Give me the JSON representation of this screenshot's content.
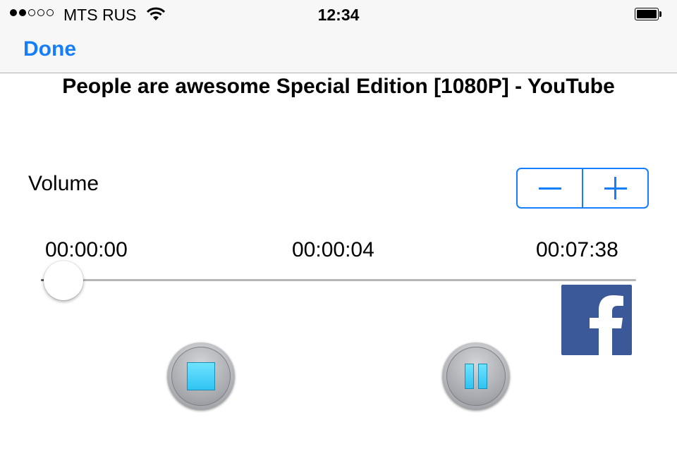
{
  "status_bar": {
    "signal_dots_filled": 2,
    "signal_dots_total": 5,
    "carrier": "MTS RUS",
    "time": "12:34",
    "icons": [
      "signal-dots-icon",
      "wifi-icon",
      "battery-icon"
    ]
  },
  "nav": {
    "done_label": "Done"
  },
  "title": "People are awesome Special Edition [1080P] - YouTube",
  "volume": {
    "label": "Volume",
    "decrement_icon": "minus-icon",
    "increment_icon": "plus-icon"
  },
  "playback": {
    "elapsed": "00:00:00",
    "current": "00:00:04",
    "duration": "00:07:38",
    "progress_fraction": 0.0
  },
  "share": {
    "icon": "facebook-icon"
  },
  "controls": {
    "stop_icon": "stop-icon",
    "pause_icon": "pause-icon"
  },
  "colors": {
    "accent": "#157efb",
    "facebook": "#3b5998",
    "control_glyph": "#2fc3f2"
  }
}
